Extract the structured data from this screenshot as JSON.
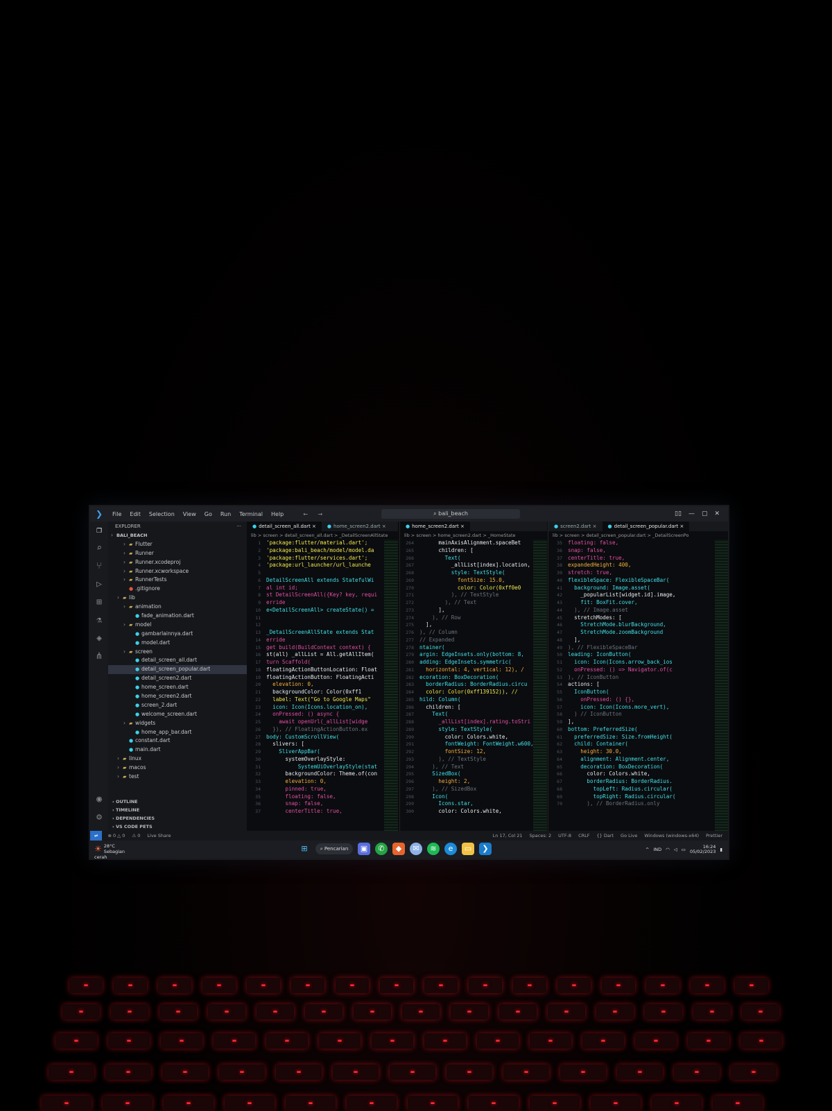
{
  "window": {
    "app_icon": "vscode-icon",
    "menu": [
      "File",
      "Edit",
      "Selection",
      "View",
      "Go",
      "Run",
      "Terminal",
      "Help"
    ],
    "search_text": "bali_beach",
    "controls": [
      "layout-icon",
      "minimize-icon",
      "maximize-icon",
      "close-icon"
    ]
  },
  "activity_bar": [
    "explorer-icon",
    "search-icon",
    "source-control-icon",
    "run-debug-icon",
    "extensions-icon",
    "testing-icon",
    "docker-icon",
    "git-graph-icon"
  ],
  "sidebar": {
    "title": "EXPLORER",
    "tree": [
      {
        "label": "BALI_BEACH",
        "kind": "root",
        "depth": 0
      },
      {
        "label": "Flutter",
        "kind": "folder",
        "depth": 2
      },
      {
        "label": "Runner",
        "kind": "folder",
        "depth": 2
      },
      {
        "label": "Runner.xcodeproj",
        "kind": "folder",
        "depth": 2
      },
      {
        "label": "Runner.xcworkspace",
        "kind": "folder",
        "depth": 2
      },
      {
        "label": "RunnerTests",
        "kind": "folder",
        "depth": 2
      },
      {
        "label": ".gitignore",
        "kind": "git",
        "depth": 2
      },
      {
        "label": "lib",
        "kind": "folder",
        "depth": 1
      },
      {
        "label": "animation",
        "kind": "folder",
        "depth": 2
      },
      {
        "label": "fade_animation.dart",
        "kind": "dart",
        "depth": 3
      },
      {
        "label": "model",
        "kind": "folder",
        "depth": 2
      },
      {
        "label": "gambarlainnya.dart",
        "kind": "dart",
        "depth": 3
      },
      {
        "label": "model.dart",
        "kind": "dart",
        "depth": 3
      },
      {
        "label": "screen",
        "kind": "folder",
        "depth": 2
      },
      {
        "label": "detail_screen_all.dart",
        "kind": "dart",
        "depth": 3
      },
      {
        "label": "detail_screen_popular.dart",
        "kind": "dart",
        "depth": 3,
        "selected": true
      },
      {
        "label": "detail_screen2.dart",
        "kind": "dart",
        "depth": 3
      },
      {
        "label": "home_screen.dart",
        "kind": "dart",
        "depth": 3
      },
      {
        "label": "home_screen2.dart",
        "kind": "dart",
        "depth": 3
      },
      {
        "label": "screen_2.dart",
        "kind": "dart",
        "depth": 3
      },
      {
        "label": "welcome_screen.dart",
        "kind": "dart",
        "depth": 3
      },
      {
        "label": "widgets",
        "kind": "folder",
        "depth": 2
      },
      {
        "label": "home_app_bar.dart",
        "kind": "dart",
        "depth": 3
      },
      {
        "label": "constant.dart",
        "kind": "dart",
        "depth": 2
      },
      {
        "label": "main.dart",
        "kind": "dart",
        "depth": 2
      },
      {
        "label": "linux",
        "kind": "folder",
        "depth": 1
      },
      {
        "label": "macos",
        "kind": "folder",
        "depth": 1
      },
      {
        "label": "test",
        "kind": "folder",
        "depth": 1
      }
    ],
    "sections": [
      "OUTLINE",
      "TIMELINE",
      "DEPENDENCIES",
      "VS CODE PETS"
    ]
  },
  "editors": [
    {
      "tabs": [
        "detail_screen_all.dart",
        "home_screen2.dart"
      ],
      "active_tab": 0,
      "breadcrumb": "lib > screen > detail_screen_all.dart > _DetailScreenAllState",
      "lines": [
        {
          "n": "1",
          "t": "'package:flutter/material.dart';",
          "c": "str"
        },
        {
          "n": "2",
          "t": "'package:bali_beach/model/model.da",
          "c": "str"
        },
        {
          "n": "3",
          "t": "'package:flutter/services.dart';",
          "c": "str"
        },
        {
          "n": "4",
          "t": "'package:url_launcher/url_launche",
          "c": "str"
        },
        {
          "n": "5",
          "t": "",
          "c": "id"
        },
        {
          "n": "6",
          "t": "DetailScreenAll extends StatefulWi",
          "c": "ty"
        },
        {
          "n": "7",
          "t": "al int id;",
          "c": "kw"
        },
        {
          "n": "8",
          "t": "st DetailScreenAll({Key? key, requi",
          "c": "kw"
        },
        {
          "n": "9",
          "t": "erride",
          "c": "kw"
        },
        {
          "n": "10",
          "t": "e<DetailScreenAll> createState() =",
          "c": "ty"
        },
        {
          "n": "11",
          "t": "",
          "c": "id"
        },
        {
          "n": "12",
          "t": "",
          "c": "id"
        },
        {
          "n": "13",
          "t": "_DetailScreenAllState extends Stat",
          "c": "ty"
        },
        {
          "n": "14",
          "t": "erride",
          "c": "kw"
        },
        {
          "n": "15",
          "t": "get build(BuildContext context) {",
          "c": "kw"
        },
        {
          "n": "16",
          "t": "st(all) _allList = All.getAllItem(",
          "c": "id"
        },
        {
          "n": "17",
          "t": "turn Scaffold(",
          "c": "kw"
        },
        {
          "n": "18",
          "t": "floatingActionButtonLocation: Float",
          "c": "id"
        },
        {
          "n": "19",
          "t": "floatingActionButton: FloatingActi",
          "c": "id"
        },
        {
          "n": "20",
          "t": "  elevation: 0,",
          "c": "num"
        },
        {
          "n": "21",
          "t": "  backgroundColor: Color(0xff1",
          "c": "id"
        },
        {
          "n": "22",
          "t": "  label: Text(\"Go to Google Maps\"",
          "c": "str"
        },
        {
          "n": "23",
          "t": "  icon: Icon(Icons.location_on),",
          "c": "ty"
        },
        {
          "n": "24",
          "t": "  onPressed: () async {",
          "c": "kw"
        },
        {
          "n": "25",
          "t": "    await openUrl(_allList[widge",
          "c": "kw"
        },
        {
          "n": "26",
          "t": "  }), // FloatingActionButton.ex",
          "c": "cm"
        },
        {
          "n": "27",
          "t": "body: CustomScrollView(",
          "c": "ty"
        },
        {
          "n": "28",
          "t": "  slivers: [",
          "c": "id"
        },
        {
          "n": "29",
          "t": "    SliverAppBar(",
          "c": "ty"
        },
        {
          "n": "30",
          "t": "      systemOverlayStyle:",
          "c": "id"
        },
        {
          "n": "31",
          "t": "          SystemUiOverlayStyle(stat",
          "c": "ty"
        },
        {
          "n": "32",
          "t": "      backgroundColor: Theme.of(con",
          "c": "id"
        },
        {
          "n": "33",
          "t": "      elevation: 0,",
          "c": "num"
        },
        {
          "n": "34",
          "t": "      pinned: true,",
          "c": "kw"
        },
        {
          "n": "35",
          "t": "      floating: false,",
          "c": "kw"
        },
        {
          "n": "36",
          "t": "      snap: false,",
          "c": "kw"
        },
        {
          "n": "37",
          "t": "      centerTitle: true,",
          "c": "kw"
        }
      ]
    },
    {
      "tabs": [
        "home_screen2.dart"
      ],
      "active_tab": 0,
      "breadcrumb": "lib > screen > home_screen2.dart > _HomeState",
      "lines": [
        {
          "n": "264",
          "t": "      mainAxisAlignment.spaceBet",
          "c": "id"
        },
        {
          "n": "265",
          "t": "      children: [",
          "c": "id"
        },
        {
          "n": "266",
          "t": "        Text(",
          "c": "ty"
        },
        {
          "n": "267",
          "t": "          _allList[index].location,",
          "c": "id"
        },
        {
          "n": "268",
          "t": "          style: TextStyle(",
          "c": "ty"
        },
        {
          "n": "269",
          "t": "            fontSize: 15.0,",
          "c": "num"
        },
        {
          "n": "270",
          "t": "            color: Color(0xff0e0",
          "c": "str"
        },
        {
          "n": "271",
          "t": "          ), // TextStyle",
          "c": "cm"
        },
        {
          "n": "272",
          "t": "        ), // Text",
          "c": "cm"
        },
        {
          "n": "273",
          "t": "      ],",
          "c": "id"
        },
        {
          "n": "274",
          "t": "    ), // Row",
          "c": "cm"
        },
        {
          "n": "275",
          "t": "  ],",
          "c": "id"
        },
        {
          "n": "276",
          "t": "), // Column",
          "c": "cm"
        },
        {
          "n": "277",
          "t": "// Expanded",
          "c": "cm"
        },
        {
          "n": "278",
          "t": "ntainer(",
          "c": "ty"
        },
        {
          "n": "279",
          "t": "argin: EdgeInsets.only(bottom: 8, ",
          "c": "ty"
        },
        {
          "n": "280",
          "t": "adding: EdgeInsets.symmetric(",
          "c": "ty"
        },
        {
          "n": "281",
          "t": "  horizontal: 4, vertical: 12), /",
          "c": "num"
        },
        {
          "n": "282",
          "t": "ecoration: BoxDecoration(",
          "c": "ty"
        },
        {
          "n": "283",
          "t": "  borderRadius: BorderRadius.circu",
          "c": "ty"
        },
        {
          "n": "284",
          "t": "  color: Color(0xff139152)), //",
          "c": "str"
        },
        {
          "n": "285",
          "t": "hild: Column(",
          "c": "ty"
        },
        {
          "n": "286",
          "t": "  children: [",
          "c": "id"
        },
        {
          "n": "287",
          "t": "    Text(",
          "c": "ty"
        },
        {
          "n": "288",
          "t": "      _allList[index].rating.toStri",
          "c": "kw"
        },
        {
          "n": "289",
          "t": "      style: TextStyle(",
          "c": "ty"
        },
        {
          "n": "290",
          "t": "        color: Colors.white,",
          "c": "id"
        },
        {
          "n": "291",
          "t": "        fontWeight: FontWeight.w600,",
          "c": "ty"
        },
        {
          "n": "292",
          "t": "        fontSize: 12,",
          "c": "num"
        },
        {
          "n": "293",
          "t": "      ), // TextStyle",
          "c": "cm"
        },
        {
          "n": "294",
          "t": "    ), // Text",
          "c": "cm"
        },
        {
          "n": "295",
          "t": "    SizedBox(",
          "c": "ty"
        },
        {
          "n": "296",
          "t": "      height: 2,",
          "c": "num"
        },
        {
          "n": "297",
          "t": "    ), // SizedBox",
          "c": "cm"
        },
        {
          "n": "298",
          "t": "    Icon(",
          "c": "ty"
        },
        {
          "n": "299",
          "t": "      Icons.star,",
          "c": "ty"
        },
        {
          "n": "300",
          "t": "      color: Colors.white,",
          "c": "id"
        }
      ]
    },
    {
      "tabs": [
        "screen2.dart",
        "detail_screen_popular.dart"
      ],
      "active_tab": 1,
      "breadcrumb": "lib > screen > detail_screen_popular.dart > _DetailScreenPo",
      "lines": [
        {
          "n": "35",
          "t": "floating: false,",
          "c": "kw"
        },
        {
          "n": "36",
          "t": "snap: false,",
          "c": "kw"
        },
        {
          "n": "37",
          "t": "centerTitle: true,",
          "c": "kw"
        },
        {
          "n": "38",
          "t": "expandedHeight: 400,",
          "c": "num"
        },
        {
          "n": "39",
          "t": "stretch: true,",
          "c": "kw"
        },
        {
          "n": "40",
          "t": "flexibleSpace: FlexibleSpaceBar(",
          "c": "ty"
        },
        {
          "n": "41",
          "t": "  background: Image.asset(",
          "c": "ty"
        },
        {
          "n": "42",
          "t": "    _popularList[widget.id].image,",
          "c": "id"
        },
        {
          "n": "43",
          "t": "    fit: BoxFit.cover,",
          "c": "ty"
        },
        {
          "n": "44",
          "t": "  ), // Image.asset",
          "c": "cm"
        },
        {
          "n": "45",
          "t": "  stretchModes: [",
          "c": "id"
        },
        {
          "n": "46",
          "t": "    StretchMode.blurBackground,",
          "c": "ty"
        },
        {
          "n": "47",
          "t": "    StretchMode.zoomBackground",
          "c": "ty"
        },
        {
          "n": "48",
          "t": "  ],",
          "c": "id"
        },
        {
          "n": "49",
          "t": "), // FlexibleSpaceBar",
          "c": "cm"
        },
        {
          "n": "50",
          "t": "leading: IconButton(",
          "c": "ty"
        },
        {
          "n": "51",
          "t": "  icon: Icon(Icons.arrow_back_ios",
          "c": "ty"
        },
        {
          "n": "52",
          "t": "  onPressed: () => Navigator.of(c",
          "c": "kw"
        },
        {
          "n": "53",
          "t": "), // IconButton",
          "c": "cm"
        },
        {
          "n": "54",
          "t": "actions: [",
          "c": "id"
        },
        {
          "n": "55",
          "t": "  IconButton(",
          "c": "ty"
        },
        {
          "n": "56",
          "t": "    onPressed: () {},",
          "c": "kw"
        },
        {
          "n": "57",
          "t": "    icon: Icon(Icons.more_vert),",
          "c": "ty"
        },
        {
          "n": "58",
          "t": "  ) // IconButton",
          "c": "cm"
        },
        {
          "n": "59",
          "t": "],",
          "c": "id"
        },
        {
          "n": "60",
          "t": "bottom: PreferredSize(",
          "c": "ty"
        },
        {
          "n": "61",
          "t": "  preferredSize: Size.fromHeight(",
          "c": "ty"
        },
        {
          "n": "62",
          "t": "  child: Container(",
          "c": "ty"
        },
        {
          "n": "63",
          "t": "    height: 30.0,",
          "c": "num"
        },
        {
          "n": "64",
          "t": "    alignment: Alignment.center,",
          "c": "ty"
        },
        {
          "n": "65",
          "t": "    decoration: BoxDecoration(",
          "c": "ty"
        },
        {
          "n": "66",
          "t": "      color: Colors.white,",
          "c": "id"
        },
        {
          "n": "67",
          "t": "      borderRadius: BorderRadius.",
          "c": "ty"
        },
        {
          "n": "68",
          "t": "        topLeft: Radius.circular(",
          "c": "ty"
        },
        {
          "n": "69",
          "t": "        topRight: Radius.circular(",
          "c": "ty"
        },
        {
          "n": "70",
          "t": "      ), // BorderRadius.only",
          "c": "cm"
        }
      ]
    }
  ],
  "statusbar": {
    "left": [
      "⊗ 0 △ 0",
      "⚠ 0",
      "Live Share"
    ],
    "right": [
      "Ln 17, Col 21",
      "Spaces: 2",
      "UTF-8",
      "CRLF",
      "{} Dart",
      "Go Live",
      "Windows (windows-x64)",
      "Prettier"
    ]
  },
  "taskbar": {
    "weather_temp": "28°C",
    "weather_desc": "Sebagian cerah",
    "search_label": "Pencarian",
    "apps": [
      "windows-start-icon",
      "task-view-icon",
      "whatsapp-icon",
      "office-icon",
      "messenger-icon",
      "spotify-icon",
      "edge-icon",
      "file-explorer-icon",
      "vscode-taskbar-icon"
    ],
    "tray_lang": "IND",
    "time": "16:24",
    "date": "05/02/2023"
  },
  "colors": {
    "keyword": "#e24fa5",
    "string": "#f2e94e",
    "type": "#3fe0e8",
    "number": "#f5b13d",
    "comment": "#6b7480",
    "keyboard_glow": "#ff2a2f"
  }
}
